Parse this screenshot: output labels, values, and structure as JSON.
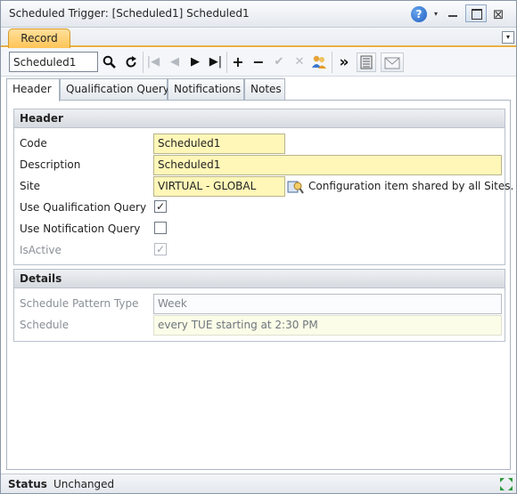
{
  "window": {
    "title": "Scheduled Trigger: [Scheduled1] Scheduled1",
    "help_glyph": "?",
    "dropdown_glyph": "▾",
    "close_glyph": "⊠"
  },
  "ribbon": {
    "active_tab": "Record",
    "dropdown_glyph": "▾",
    "accent": "#ffc457"
  },
  "toolbar": {
    "record_value": "Scheduled1",
    "buttons": {
      "search": "search-icon",
      "refresh": "refresh-icon",
      "first": "⏮",
      "prev": "◀",
      "next": "▶",
      "last": "▶|",
      "add": "+",
      "remove": "−",
      "confirm": "✔",
      "cancel": "✕",
      "more": "»"
    },
    "first_glyph": "|◀",
    "prev_glyph": "◀",
    "next_glyph": "▶",
    "last_glyph": "▶|",
    "add_glyph": "+",
    "remove_glyph": "−",
    "confirm_glyph": "✔",
    "cancel_glyph": "✕",
    "more_glyph": "»"
  },
  "tabs": [
    {
      "label": "Header",
      "active": true
    },
    {
      "label": "Qualification Query",
      "active": false
    },
    {
      "label": "Notifications",
      "active": false
    },
    {
      "label": "Notes",
      "active": false
    }
  ],
  "header_section": {
    "title": "Header",
    "code_label": "Code",
    "code_value": "Scheduled1",
    "description_label": "Description",
    "description_value": "Scheduled1",
    "site_label": "Site",
    "site_value": "VIRTUAL - GLOBAL",
    "site_note": "Configuration item shared by all Sites.",
    "use_qualification_label": "Use Qualification Query",
    "use_qualification_checked": "✓",
    "use_notification_label": "Use Notification Query",
    "use_notification_checked": "",
    "isactive_label": "IsActive",
    "isactive_checked": "✓"
  },
  "details_section": {
    "title": "Details",
    "pattern_label": "Schedule Pattern Type",
    "pattern_value": "Week",
    "schedule_label": "Schedule",
    "schedule_value": "every TUE starting at 2:30 PM"
  },
  "status": {
    "label": "Status",
    "value": "Unchanged"
  }
}
